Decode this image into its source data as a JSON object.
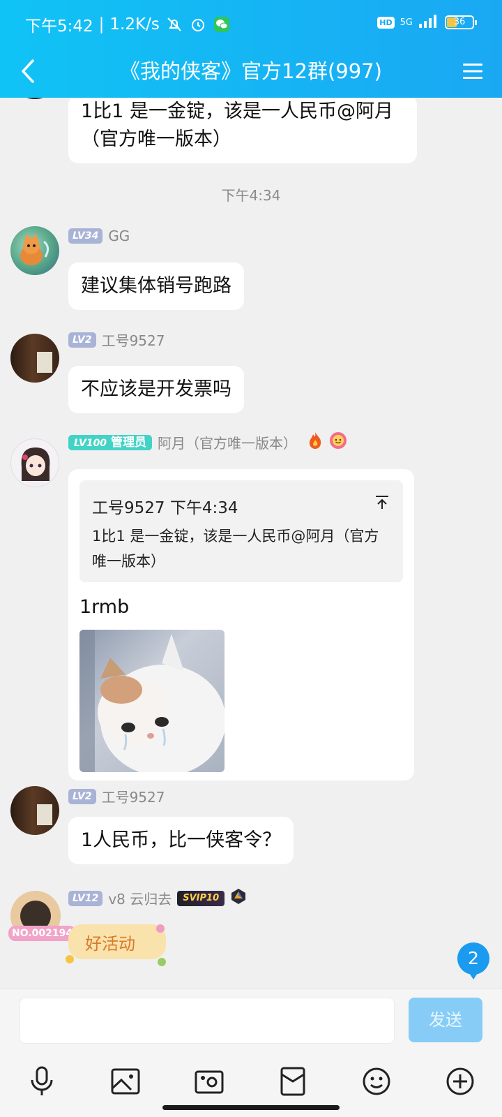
{
  "status_bar": {
    "time": "下午5:42",
    "separator": "|",
    "net_speed": "1.2K/s",
    "hd_label": "HD",
    "network_label": "5G",
    "battery_level": "36"
  },
  "nav": {
    "title": "《我的侠客》官方12群(997)"
  },
  "messages": {
    "top_partial": {
      "text": "1比1  是一金锭，该是一人民币@阿月（官方唯一版本）"
    },
    "time_divider": "下午4:34",
    "gg": {
      "level": "LV34",
      "name": "GG",
      "text": "建议集体销号跑路"
    },
    "gh1": {
      "level": "LV2",
      "name": "工号9527",
      "text": "不应该是开发票吗"
    },
    "ayue": {
      "level": "LV100",
      "role": "管理员",
      "name": "阿月（官方唯一版本）",
      "quote_header": "工号9527 下午4:34",
      "quote_text": "1比1  是一金锭，该是一人民币@阿月（官方唯一版本）",
      "reply": "1rmb"
    },
    "gh2": {
      "level": "LV2",
      "name": "工号9527",
      "text": "1人民币，比一侠客令？"
    },
    "v8": {
      "level": "LV12",
      "name": "v8 云归去",
      "svip_badge": "SVIP10",
      "avatar_tag": "NO.002194",
      "sticker_text": "好活动"
    }
  },
  "unread_count": "2",
  "composer": {
    "send_label": "发送"
  },
  "colors": {
    "header_start": "#10c3f5",
    "header_end": "#1aa8f3",
    "chat_bg": "#f0f0f0",
    "send_button": "#86ccf6",
    "unread_badge": "#1a9bf0",
    "admin_badge": "#43d3c6"
  },
  "icons": {
    "back": "chevron-left-icon",
    "menu": "hamburger-menu-icon",
    "tools": [
      "microphone-icon",
      "image-icon",
      "camera-icon",
      "red-packet-icon",
      "emoji-icon",
      "plus-icon"
    ]
  }
}
